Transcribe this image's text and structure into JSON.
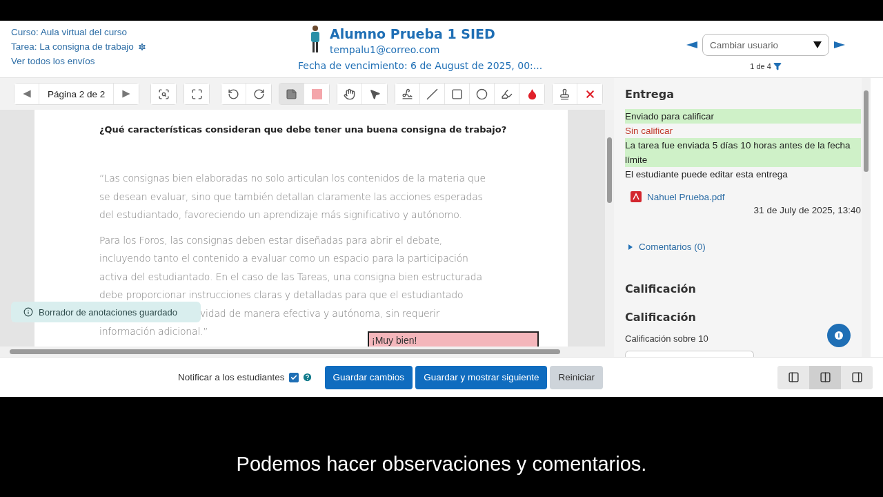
{
  "header": {
    "course": "Curso: Aula virtual del curso",
    "assignment": "Tarea: La consigna de trabajo",
    "view_all": "Ver todos los envíos",
    "student_name": "Alumno Prueba 1 SIED",
    "email": "tempalu1@correo.com",
    "due_date": "Fecha de vencimiento: 6 de August de 2025, 00:...",
    "user_select": {
      "placeholder": "Cambiar usuario"
    },
    "counter": "1 de 4"
  },
  "toolbar": {
    "page_label": "Página 2 de 2",
    "groups": [
      [
        {
          "kind": "search",
          "selected": false
        }
      ],
      [
        {
          "kind": "expand",
          "selected": false
        }
      ],
      [
        {
          "kind": "rotate-left",
          "selected": false
        },
        {
          "kind": "rotate-right",
          "selected": false
        }
      ],
      [
        {
          "kind": "comment",
          "selected": true
        },
        {
          "kind": "swatch",
          "selected": false,
          "color": "#f4a6ab"
        }
      ],
      [
        {
          "kind": "hand",
          "selected": false
        },
        {
          "kind": "pointer",
          "selected": false
        }
      ],
      [
        {
          "kind": "pen",
          "selected": false
        },
        {
          "kind": "line",
          "selected": false
        },
        {
          "kind": "rectangle",
          "selected": false
        },
        {
          "kind": "oval",
          "selected": false
        },
        {
          "kind": "highlighter",
          "selected": false
        },
        {
          "kind": "drop",
          "selected": false
        }
      ],
      [
        {
          "kind": "stamp",
          "selected": false
        },
        {
          "kind": "delete",
          "selected": false
        }
      ]
    ]
  },
  "document": {
    "question": "¿Qué características consideran que debe tener una buena consigna de trabajo?",
    "paragraphs": [
      [
        {
          "kind": "line",
          "text": "“Las consignas bien elaboradas no solo articulan los contenidos de la materia que"
        },
        {
          "kind": "line",
          "text": "se desean evaluar, sino que también detallan claramente las acciones esperadas"
        },
        {
          "kind": "line",
          "text": "del estudiantado, favoreciendo un aprendizaje más significativo y autónomo."
        }
      ],
      [
        {
          "kind": "line",
          "text": "Para los Foros, las consignas deben estar diseñadas para abrir el debate,"
        },
        {
          "kind": "line",
          "text": "incluyendo tanto el contenido a evaluar como un espacio para la participación"
        },
        {
          "kind": "line",
          "text": "activa del estudiantado. En el caso de las Tareas, una consigna bien estructurada"
        },
        {
          "kind": "line",
          "text": "debe proporcionar instrucciones claras y detalladas para que el estudiantado"
        },
        {
          "kind": "partial",
          "text": "vidad de manera efectiva y autónoma, sin requerir"
        },
        {
          "kind": "line",
          "text": "información adicional.”"
        }
      ]
    ],
    "annotation": "¡Muy bien!",
    "toast": "Borrador de anotaciones guardado"
  },
  "panel": {
    "heading": "Entrega",
    "statuses": [
      {
        "kind": "success",
        "text": "Enviado para calificar"
      },
      {
        "kind": "danger",
        "text": "Sin calificar"
      },
      {
        "kind": "success",
        "text": "La tarea fue enviada 5 días 10 horas antes de la fecha límite"
      },
      {
        "kind": "plain",
        "text": "El estudiante puede editar esta entrega"
      }
    ],
    "file": "Nahuel Prueba.pdf",
    "file_date": "31 de July de 2025, 13:40",
    "comments": {
      "label": "Comentarios (0)",
      "expanded": false
    },
    "grade_heading": "Calificación",
    "grade_subheading": "Calificación",
    "grade_label": "Calificación sobre 10"
  },
  "footer": {
    "notify": {
      "label": "Notificar a los estudiantes",
      "checked": true
    },
    "buttons": [
      {
        "kind": "primary",
        "label": "Guardar cambios"
      },
      {
        "kind": "primary",
        "label": "Guardar y mostrar siguiente"
      },
      {
        "kind": "secondary",
        "label": "Reiniciar"
      }
    ],
    "layouts": [
      {
        "kind": "left",
        "selected": false
      },
      {
        "kind": "split",
        "selected": true
      },
      {
        "kind": "right",
        "selected": false
      }
    ]
  },
  "subtitle": "Podemos hacer observaciones y comentarios."
}
